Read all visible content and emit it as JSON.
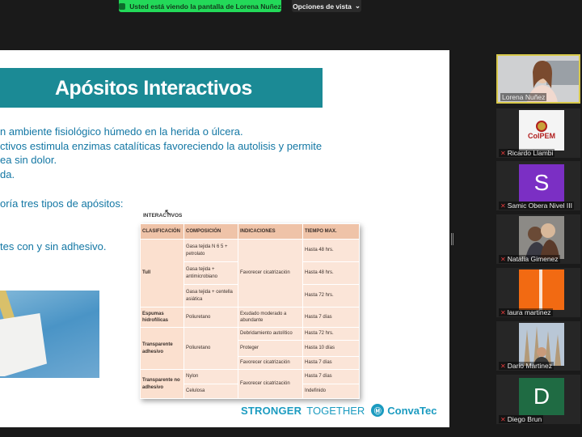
{
  "topbar": {
    "share_notice": "Usted está viendo la pantalla de Lorena Nuñez",
    "view_options": "Opciones de vista",
    "chevron": "⌄"
  },
  "slide": {
    "title": "Apósitos Interactivos",
    "bullets": [
      "n ambiente fisiológico húmedo en la herida o úlcera.",
      "ctivos estimula enzimas catalíticas favoreciendo la autolisis y permite",
      "ea sin dolor.",
      "da.",
      "oría tres tipos de apósitos:",
      "tes con y sin adhesivo."
    ],
    "table_caption": "INTERACTIVOS",
    "table": {
      "headers": [
        "CLASIFICACIÓN",
        "COMPOSICIÓN",
        "INDICACIONES",
        "TIEMPO MAX."
      ],
      "tull": {
        "group": "Tull",
        "composicion": [
          "Gasa tejida N 6 5 + petrolato",
          "Gasa tejida + antimicrobiano",
          "Gasa tejida + centella asiática"
        ],
        "indicacion": "Favorecer cicatrización",
        "tiempo": [
          "Hasta 48 hrs.",
          "Hasta 48 hrs.",
          "Hasta 72 hrs."
        ]
      },
      "espumas": {
        "group": "Espumas hidrofílicas",
        "composicion": "Poliuretano",
        "indicacion": "Exudado moderado a abundante",
        "tiempo": "Hasta 7 días"
      },
      "transparente": {
        "group": "Transparente adhesivo",
        "composicion": "Poliuretano",
        "indicaciones": [
          "Debridamiento autolítico",
          "Proteger",
          "Favorecer cicatrización"
        ],
        "tiempo": [
          "Hasta 72 hrs.",
          "Hasta 10 días",
          "Hasta 7 días"
        ]
      },
      "transparente_no": {
        "group": "Transparente no adhesivo",
        "composicion": [
          "Nylon",
          "Celulosa"
        ],
        "indicacion": "Favorecer cicatrización",
        "tiempo": [
          "Hasta 7 días",
          "Indefinido"
        ]
      }
    },
    "footer": {
      "stronger": "STRONGER",
      "together": "TOGETHER",
      "logo_letter": "Ⓜ",
      "brand": "ConvaTec"
    }
  },
  "participants": [
    {
      "name": "Lorena Nuñez",
      "type": "video",
      "active": true,
      "muted": false
    },
    {
      "name": "Ricardo Llambi",
      "type": "logo",
      "muted": true,
      "logo_text": "ColPEM"
    },
    {
      "name": "Samic Obera Nivel III",
      "type": "letter",
      "letter": "S",
      "color": "#7b2fc4",
      "muted": true
    },
    {
      "name": "Natalia Gimenez",
      "type": "photo",
      "muted": true
    },
    {
      "name": "laura martinez",
      "type": "color",
      "color": "#f26a12",
      "muted": true
    },
    {
      "name": "Dario Martinez",
      "type": "photo",
      "muted": true
    },
    {
      "name": "Diego Brun",
      "type": "letter",
      "letter": "D",
      "color": "#1f6b43",
      "muted": true
    }
  ],
  "colors": {
    "slide_accent": "#1b8a95",
    "text_blue": "#1377a4",
    "share_green": "#23d959",
    "muted_red": "#e23b3b"
  },
  "icons": {
    "muted": "mic-muted-icon",
    "share": "screen-share-icon"
  }
}
